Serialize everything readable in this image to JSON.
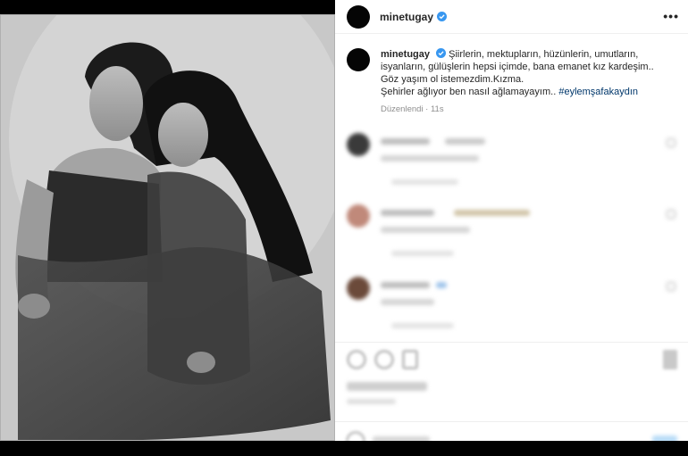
{
  "post": {
    "username": "minetugay",
    "more_icon": "more-horizontal-icon",
    "verified_icon": "verified-badge-icon",
    "caption_lines": [
      "Şiirlerin, mektupların, hüzünlerin, umutların,",
      "isyanların, gülüşlerin hepsi içimde, bana emanet kız kardeşim..",
      "Göz yaşım ol istemezdim.Kızma.",
      "Şehirler ağlıyor ben nasıl ağlamayayım.."
    ],
    "hashtag": "#eylemşafakaydın",
    "edited": "Düzenlendi · 11s"
  },
  "colors": {
    "hashtag": "#00376b",
    "verified": "#3897f0",
    "muted": "#8e8e8e"
  },
  "icons": {
    "like": "heart-icon",
    "comment": "comment-icon",
    "share": "share-icon",
    "save": "bookmark-icon",
    "emoji": "emoji-icon"
  }
}
